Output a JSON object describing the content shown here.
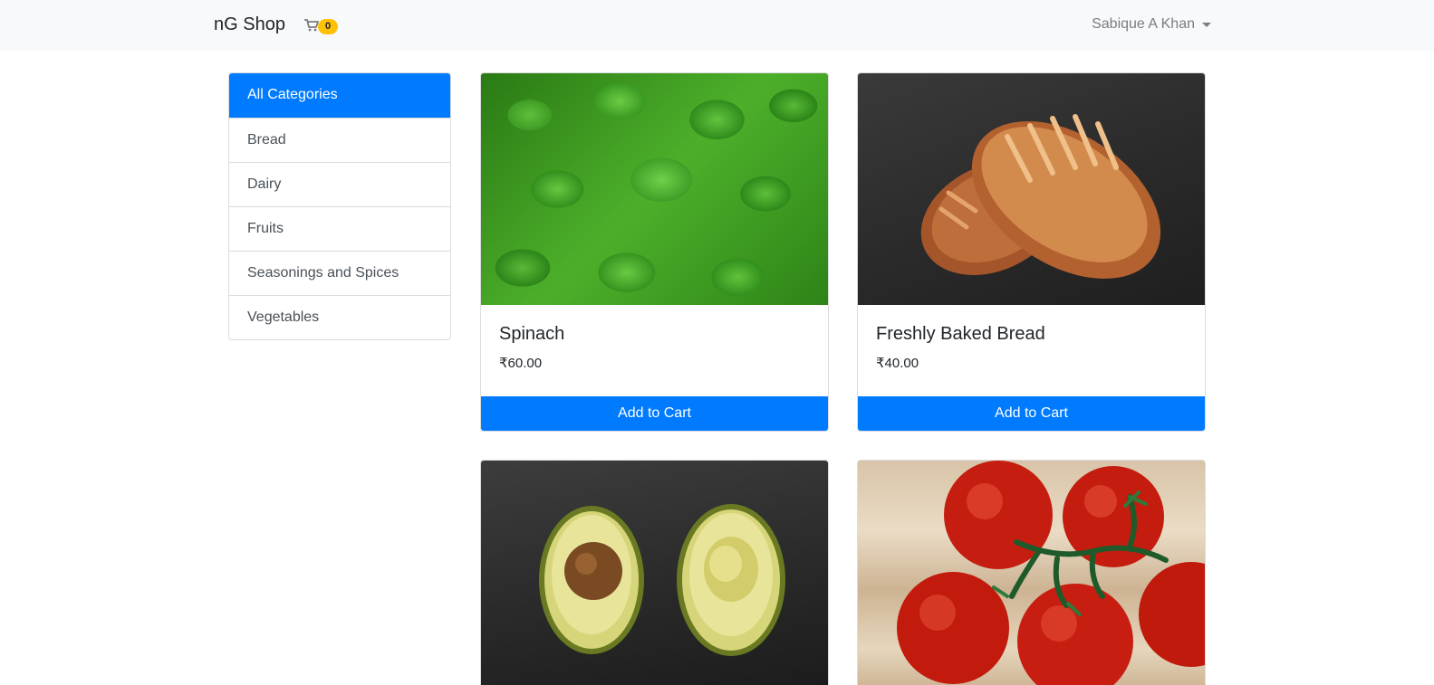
{
  "navbar": {
    "brand": "nG Shop",
    "cart_count": "0",
    "user_name": "Sabique A Khan"
  },
  "categories": {
    "active": "All Categories",
    "items": [
      "Bread",
      "Dairy",
      "Fruits",
      "Seasonings and Spices",
      "Vegetables"
    ]
  },
  "products": [
    {
      "title": "Spinach",
      "price": "₹60.00",
      "button": "Add to Cart"
    },
    {
      "title": "Freshly Baked Bread",
      "price": "₹40.00",
      "button": "Add to Cart"
    },
    {
      "title": "",
      "price": "",
      "button": ""
    },
    {
      "title": "",
      "price": "",
      "button": ""
    }
  ],
  "colors": {
    "primary": "#007bff",
    "badge": "#ffc107",
    "navbar_bg": "#f8f9fa"
  }
}
